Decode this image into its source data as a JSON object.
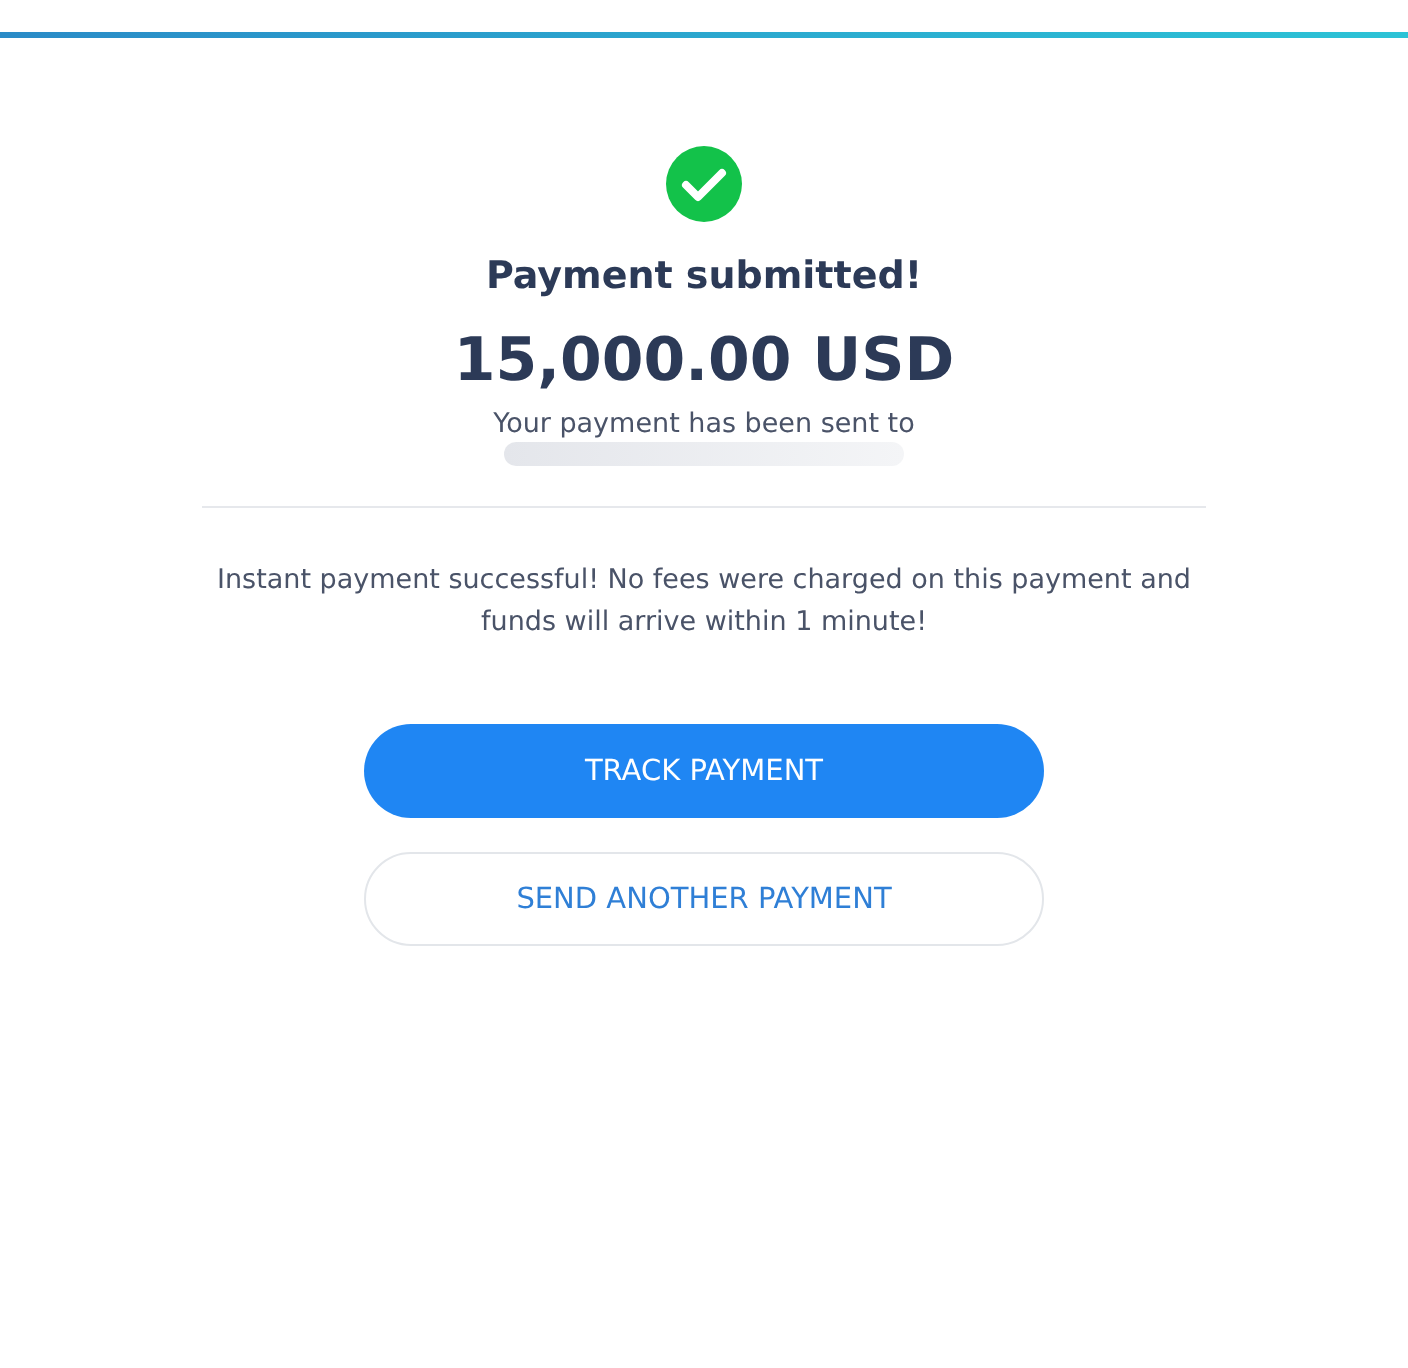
{
  "status": {
    "kind": "success",
    "title": "Payment submitted!"
  },
  "amount": "15,000.00 USD",
  "recipient_text": "Your payment has been sent to",
  "note": "Instant payment successful! No fees were charged on this payment and funds will arrive within 1 minute!",
  "buttons": [
    {
      "label": "TRACK PAYMENT",
      "kind": "primary"
    },
    {
      "label": "SEND ANOTHER PAYMENT",
      "kind": "secondary"
    }
  ]
}
